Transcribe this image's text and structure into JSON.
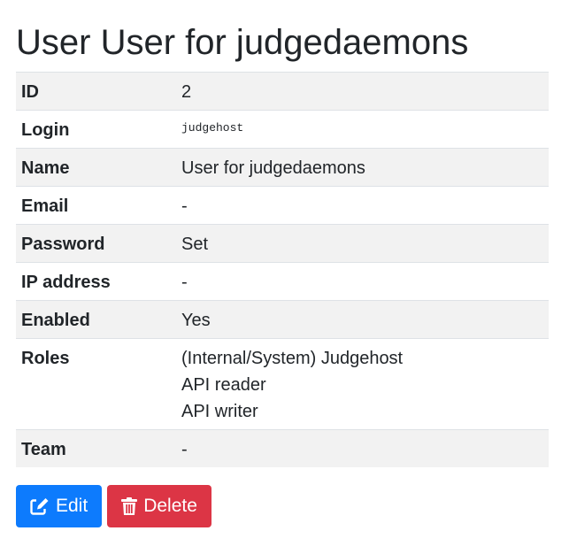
{
  "page": {
    "title": "User User for judgedaemons"
  },
  "details": {
    "rows": [
      {
        "label": "ID",
        "value": "2"
      },
      {
        "label": "Login",
        "value": "judgehost"
      },
      {
        "label": "Name",
        "value": "User for judgedaemons"
      },
      {
        "label": "Email",
        "value": "-"
      },
      {
        "label": "Password",
        "value": "Set"
      },
      {
        "label": "IP address",
        "value": "-"
      },
      {
        "label": "Enabled",
        "value": "Yes"
      },
      {
        "label": "Roles",
        "values": [
          "(Internal/System) Judgehost",
          "API reader",
          "API writer"
        ]
      },
      {
        "label": "Team",
        "value": "-"
      }
    ]
  },
  "actions": {
    "edit": {
      "label": "Edit",
      "icon": "edit-icon",
      "color": "#0d7bfd"
    },
    "delete": {
      "label": "Delete",
      "icon": "trash-icon",
      "color": "#dc3545"
    }
  }
}
